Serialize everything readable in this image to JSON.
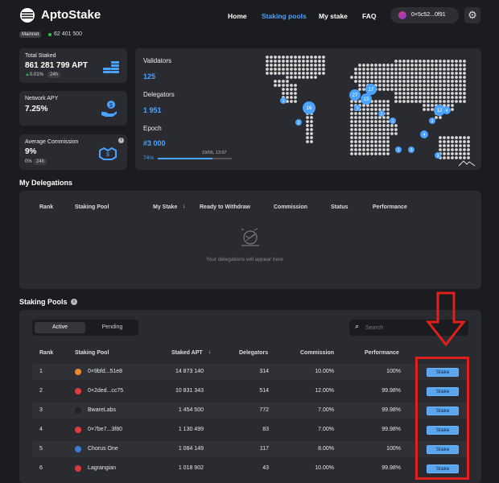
{
  "app": {
    "title": "AptoStake"
  },
  "nav": {
    "home": "Home",
    "staking_pools": "Staking pools",
    "my_stake": "My stake",
    "faq": "FAQ",
    "wallet": "0×5c52...0f91"
  },
  "network": {
    "badge": "Mainnet",
    "block": "62 401 500"
  },
  "stats": {
    "total_staked": {
      "label": "Total Staked",
      "value": "861 281 799 APT",
      "change": "0.01%",
      "period": "24h"
    },
    "network_apy": {
      "label": "Network APY",
      "value": "7.25%"
    },
    "avg_commission": {
      "label": "Average Commission",
      "value": "9%",
      "change": "0%",
      "period": "24h"
    }
  },
  "network_panel": {
    "validators_label": "Validators",
    "validators_value": "125",
    "delegators_label": "Delegators",
    "delegators_value": "1 951",
    "epoch_label": "Epoch",
    "epoch_value": "#3 000",
    "epoch_progress_text": "74%",
    "epoch_progress": 0.74,
    "epoch_time": "19/06, 13:07",
    "map_markers": [
      "1",
      "16",
      "2",
      "27",
      "13",
      "17",
      "1",
      "1",
      "1",
      "3",
      "12",
      "4",
      "4",
      "3",
      "1",
      "3"
    ]
  },
  "my_delegations": {
    "title": "My Delegations",
    "columns": [
      "Rank",
      "Staking Pool",
      "My Stake",
      "Ready to Withdraw",
      "Commission",
      "Status",
      "Performance"
    ],
    "sort_icon": "↓",
    "empty_text": "Your delegations will appear here"
  },
  "staking_pools": {
    "title": "Staking Pools",
    "tabs": [
      "Active",
      "Pending"
    ],
    "search_placeholder": "Search",
    "columns": [
      "Rank",
      "Staking Pool",
      "Staked APT",
      "Delegators",
      "Commission",
      "Performance"
    ],
    "sort_icon": "↓",
    "button_label": "Stake",
    "rows": [
      {
        "rank": "1",
        "pool": "0×9bfd...51e8",
        "staked": "14 873 140",
        "delegators": "314",
        "commission": "10.00%",
        "performance": "100%",
        "icon_color": "#f08a24"
      },
      {
        "rank": "2",
        "pool": "0×2ded...cc75",
        "staked": "10 831 343",
        "delegators": "514",
        "commission": "12.00%",
        "performance": "99.98%",
        "icon_color": "#e23b3b"
      },
      {
        "rank": "3",
        "pool": "BwareLabs",
        "staked": "1 454 500",
        "delegators": "772",
        "commission": "7.00%",
        "performance": "99.98%",
        "icon_color": "#222222"
      },
      {
        "rank": "4",
        "pool": "0×7be7...3f80",
        "staked": "1 130 499",
        "delegators": "83",
        "commission": "7.00%",
        "performance": "99.98%",
        "icon_color": "#e23b3b"
      },
      {
        "rank": "5",
        "pool": "Chorus One",
        "staked": "1 084 149",
        "delegators": "117",
        "commission": "8.00%",
        "performance": "100%",
        "icon_color": "#3a7bd5"
      },
      {
        "rank": "6",
        "pool": "Lagrangian",
        "staked": "1 018 902",
        "delegators": "43",
        "commission": "10.00%",
        "performance": "99.98%",
        "icon_color": "#d63a3a"
      }
    ]
  },
  "colors": {
    "accent": "#4aa3ff",
    "green": "#30c24a",
    "annotation_red": "#e0201c",
    "button": "#5aa7f0"
  }
}
